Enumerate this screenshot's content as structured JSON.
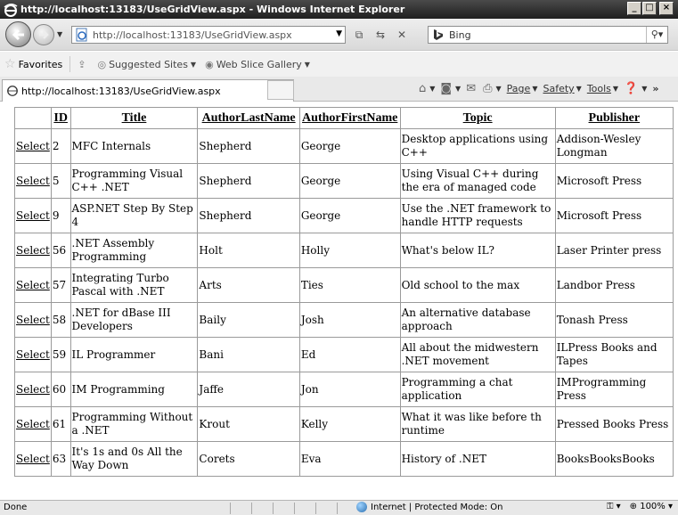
{
  "window": {
    "title": "http://localhost:13183/UseGridView.aspx - Windows Internet Explorer"
  },
  "navigation": {
    "address": "http://localhost:13183/UseGridView.aspx",
    "address_host": "localhost",
    "search_placeholder": "Bing"
  },
  "favorites_bar": {
    "favorites_label": "Favorites",
    "suggested_sites": "Suggested Sites",
    "web_slice_gallery": "Web Slice Gallery"
  },
  "tab": {
    "title": "http://localhost:13183/UseGridView.aspx"
  },
  "command_bar": {
    "page": "Page",
    "safety": "Safety",
    "tools": "Tools"
  },
  "grid": {
    "select_label": "Select",
    "headers": [
      "",
      "ID",
      "Title",
      "AuthorLastName",
      "AuthorFirstName",
      "Topic",
      "Publisher"
    ],
    "rows": [
      {
        "id": "2",
        "title": "MFC Internals",
        "last": "Shepherd",
        "first": "George",
        "topic": "Desktop applications using C++",
        "publisher": "Addison-Wesley Longman"
      },
      {
        "id": "5",
        "title": "Programming Visual C++ .NET",
        "last": "Shepherd",
        "first": "George",
        "topic": "Using Visual C++ during the era of managed code",
        "publisher": "Microsoft Press"
      },
      {
        "id": "9",
        "title": "ASP.NET Step By Step 4",
        "last": "Shepherd",
        "first": "George",
        "topic": "Use the .NET framework to handle HTTP requests",
        "publisher": "Microsoft Press"
      },
      {
        "id": "56",
        "title": ".NET Assembly Programming",
        "last": "Holt",
        "first": "Holly",
        "topic": "What's below IL?",
        "publisher": "Laser Printer press"
      },
      {
        "id": "57",
        "title": "Integrating Turbo Pascal with .NET",
        "last": "Arts",
        "first": "Ties",
        "topic": "Old school to the max",
        "publisher": "Landbor Press"
      },
      {
        "id": "58",
        "title": ".NET for dBase III Developers",
        "last": "Baily",
        "first": "Josh",
        "topic": "An alternative database approach",
        "publisher": "Tonash Press"
      },
      {
        "id": "59",
        "title": "IL Programmer",
        "last": "Bani",
        "first": "Ed",
        "topic": "All about the midwestern .NET movement",
        "publisher": "ILPress Books and Tapes"
      },
      {
        "id": "60",
        "title": "IM Programming",
        "last": "Jaffe",
        "first": "Jon",
        "topic": "Programming a chat application",
        "publisher": "IMProgramming Press"
      },
      {
        "id": "61",
        "title": "Programming Without a .NET",
        "last": "Krout",
        "first": "Kelly",
        "topic": "What it was like before th runtime",
        "publisher": "Pressed Books Press"
      },
      {
        "id": "63",
        "title": "It's 1s and 0s All the Way Down",
        "last": "Corets",
        "first": "Eva",
        "topic": "History of .NET",
        "publisher": "BooksBooksBooks"
      }
    ]
  },
  "status_bar": {
    "left": "Done",
    "zone": "Internet | Protected Mode: On",
    "zoom": "100%"
  },
  "colors": {
    "titlebar": "#2b2b2b",
    "chrome": "#e9e9e9",
    "grid_border": "#9a9a9a"
  }
}
